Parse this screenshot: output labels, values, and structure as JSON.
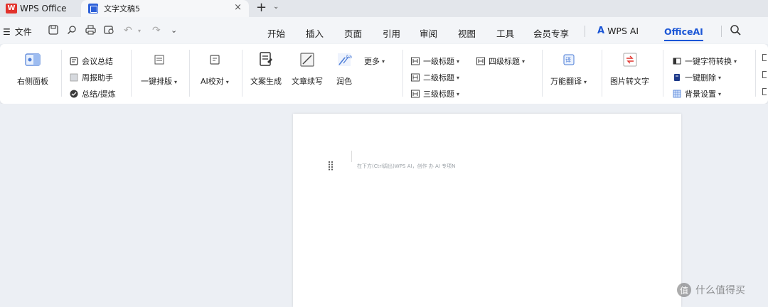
{
  "titlebar": {
    "app_name": "WPS Office",
    "doc_tab_label": "文字文稿5",
    "close_glyph": "×",
    "new_tab_glyph": "+",
    "new_tab_dropdown_glyph": "⌄"
  },
  "menu": {
    "file_label": "文件",
    "tabs": [
      "开始",
      "插入",
      "页面",
      "引用",
      "审阅",
      "视图",
      "工具",
      "会员专享"
    ],
    "wps_ai_label": "WPS AI",
    "office_ai_label": "OfficeAI",
    "active_tab": "OfficeAI"
  },
  "ribbon": {
    "right_panel": "右侧面板",
    "meeting_summary": "会议总结",
    "weekly_report": "周报助手",
    "summary_refine": "总结/提炼",
    "one_click_layout": "一键排版",
    "ai_proofread": "AI校对",
    "copy_generate": "文案生成",
    "copy_continue": "文章续写",
    "polish": "润色",
    "more": "更多",
    "heading1": "一级标题",
    "heading2": "二级标题",
    "heading3": "三级标题",
    "heading4": "四级标题",
    "translate": "万能翻译",
    "image_to_text": "图片转文字",
    "char_convert": "一键字符转换",
    "one_click_delete": "一键删除",
    "background_settings": "背景设置"
  },
  "document": {
    "placeholder": "在下方(Ctrl调出)WPS AI，创作 办 AI 专项N"
  },
  "watermark": {
    "icon_text": "值",
    "text": "什么值得买"
  },
  "colors": {
    "accent": "#1b56d6",
    "wps_red": "#e2322c",
    "ribbon_bg": "#ffffff",
    "workarea_bg": "#eceff4"
  }
}
